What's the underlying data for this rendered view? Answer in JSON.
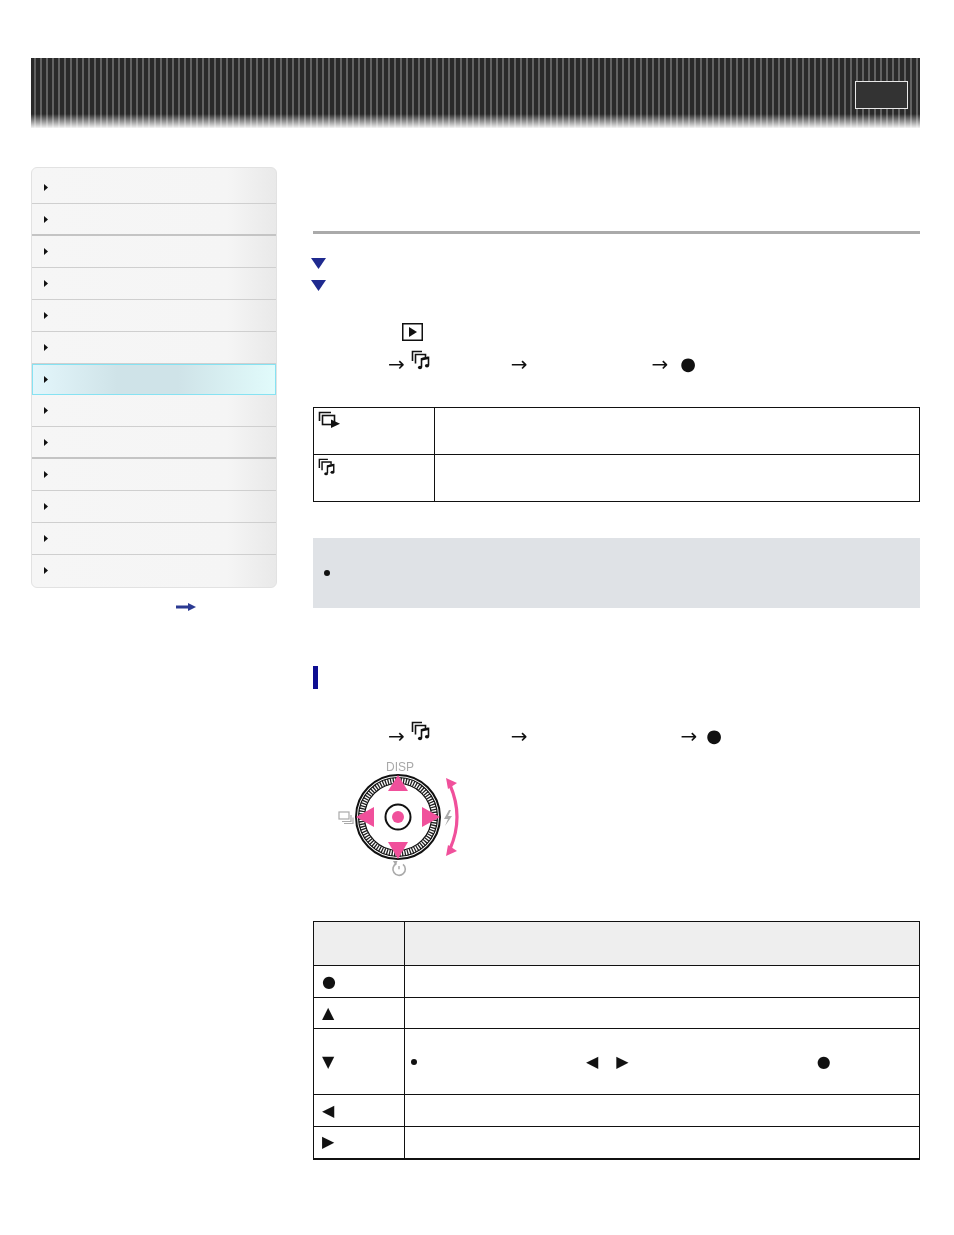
{
  "sidebar": {
    "groups": [
      {
        "items": [
          {
            "selected": false
          },
          {
            "selected": false
          }
        ]
      },
      {
        "items": [
          {
            "selected": false
          },
          {
            "selected": false
          },
          {
            "selected": false
          },
          {
            "selected": false
          },
          {
            "selected": true
          },
          {
            "selected": false
          },
          {
            "selected": false
          }
        ]
      },
      {
        "items": [
          {
            "selected": false
          },
          {
            "selected": false
          },
          {
            "selected": false
          },
          {
            "selected": false
          }
        ]
      }
    ]
  },
  "section_1": {
    "menu_path": [
      "→",
      "→",
      "→",
      "●"
    ],
    "table": {
      "rows": [
        {
          "kind": "slideshow"
        },
        {
          "kind": "music"
        }
      ]
    }
  },
  "section_2": {
    "menu_path": [
      "→",
      "→",
      "→",
      "●"
    ],
    "wheel_label": "DISP",
    "table": {
      "rows": [
        {
          "key": "●"
        },
        {
          "key": "▲"
        },
        {
          "key": "▼",
          "detail": [
            "◀",
            "▶",
            "●"
          ]
        },
        {
          "key": "◀"
        },
        {
          "key": "▶"
        }
      ]
    }
  }
}
